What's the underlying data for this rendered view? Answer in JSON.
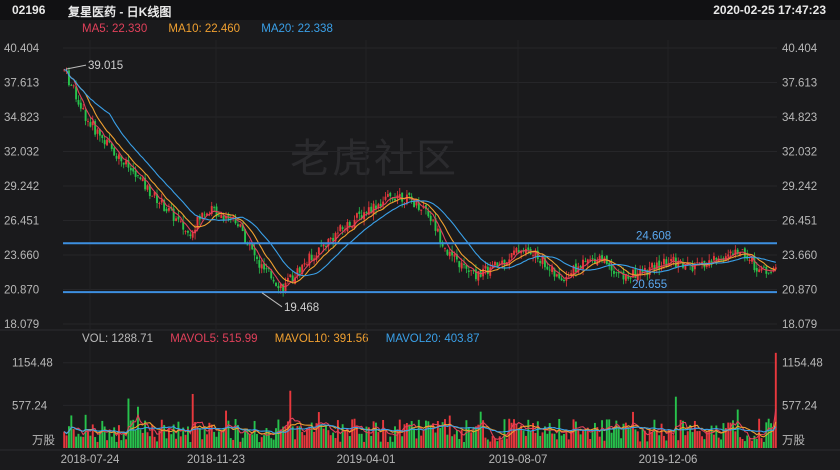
{
  "header": {
    "code": "02196",
    "title": "复星医药 - 日K线图",
    "datetime": "2020-02-25 17:47:23"
  },
  "watermark": "老虎社区",
  "ma_legend": [
    {
      "label": "MA5: 22.330",
      "color": "#e0405a"
    },
    {
      "label": "MA10: 22.460",
      "color": "#f0a030"
    },
    {
      "label": "MA20: 22.338",
      "color": "#3aa0e8"
    }
  ],
  "vol_legend": [
    {
      "label": "VOL: 1288.71",
      "color": "#bbbbbb"
    },
    {
      "label": "MAVOL5: 515.99",
      "color": "#e0405a"
    },
    {
      "label": "MAVOL10: 391.56",
      "color": "#f0a030"
    },
    {
      "label": "MAVOL20: 403.87",
      "color": "#3aa0e8"
    }
  ],
  "colors": {
    "up": "#e8383d",
    "down": "#27c24c",
    "ma5": "#e0405a",
    "ma10": "#f0a030",
    "ma20": "#3aa0e8",
    "hline": "#3d8fe0"
  },
  "chart_data": {
    "type": "candlestick",
    "price_axis": {
      "ylim": [
        18.079,
        40.404
      ],
      "ticks": [
        "40.404",
        "37.613",
        "34.823",
        "32.032",
        "29.242",
        "26.451",
        "23.660",
        "20.870",
        "18.079"
      ]
    },
    "volume_axis": {
      "ylim": [
        0,
        1300
      ],
      "ticks": [
        {
          "v": 1154.48,
          "label": "1154.48"
        },
        {
          "v": 577.24,
          "label": "577.24"
        }
      ],
      "unit": "万股"
    },
    "x_tick_labels": [
      "2018-07-24",
      "2018-11-23",
      "2019-04-01",
      "2019-08-07",
      "2019-12-06"
    ],
    "annotations": {
      "high": "39.015",
      "low": "19.468"
    },
    "horizontal_lines": [
      {
        "value": 24.608,
        "label": "24.608"
      },
      {
        "value": 20.655,
        "label": "20.655"
      }
    ],
    "trend": [
      [
        0,
        38.6
      ],
      [
        10,
        34.5
      ],
      [
        22,
        31.8
      ],
      [
        35,
        29.0
      ],
      [
        44,
        27.2
      ],
      [
        52,
        25.4
      ],
      [
        60,
        27.4
      ],
      [
        72,
        26.6
      ],
      [
        82,
        22.8
      ],
      [
        92,
        21.0
      ],
      [
        102,
        23.2
      ],
      [
        115,
        25.5
      ],
      [
        128,
        27.4
      ],
      [
        140,
        28.6
      ],
      [
        152,
        27.4
      ],
      [
        162,
        23.6
      ],
      [
        172,
        22.0
      ],
      [
        182,
        22.8
      ],
      [
        192,
        24.2
      ],
      [
        200,
        23.4
      ],
      [
        208,
        21.6
      ],
      [
        215,
        22.6
      ],
      [
        225,
        23.6
      ],
      [
        235,
        21.8
      ],
      [
        245,
        22.4
      ],
      [
        255,
        23.2
      ],
      [
        265,
        22.6
      ],
      [
        275,
        23.4
      ],
      [
        285,
        24.0
      ],
      [
        292,
        22.4
      ]
    ],
    "n_bars": 300,
    "last_volume": 1288.71
  }
}
